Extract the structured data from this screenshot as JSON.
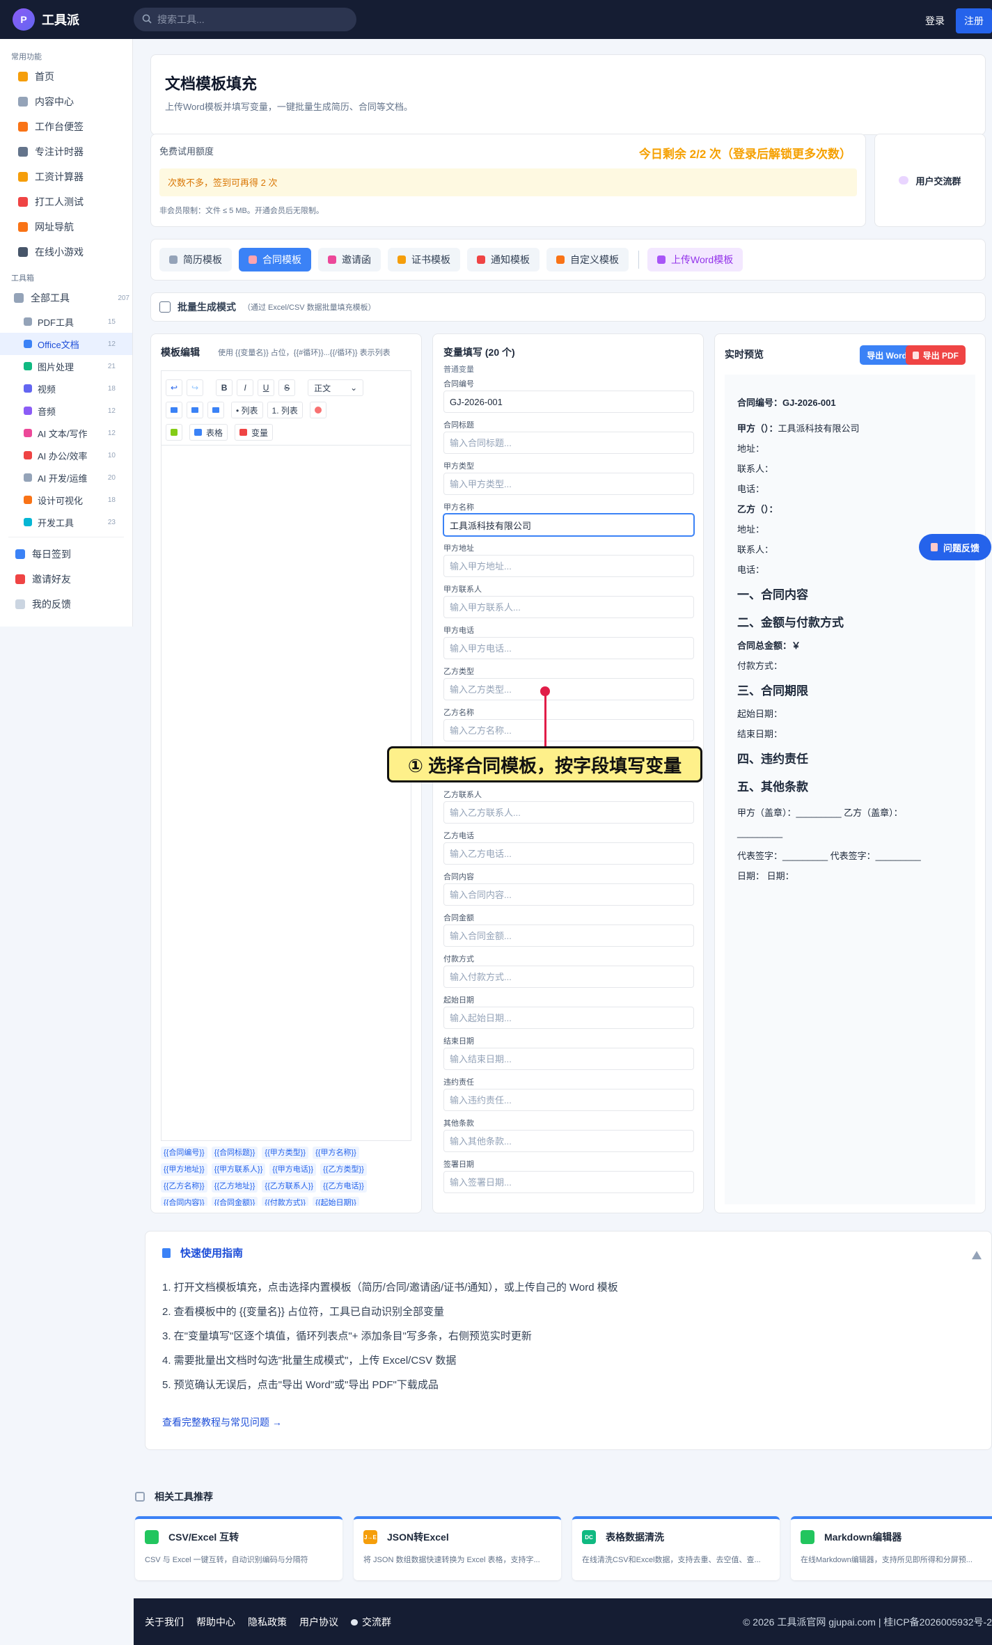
{
  "header": {
    "logo_mark": "P",
    "logo": "工具派",
    "search_placeholder": "搜索工具...",
    "login": "登录",
    "register": "注册"
  },
  "sidebar": {
    "common_caption": "常用功能",
    "common": [
      {
        "label": "首页",
        "color": "#f59e0b"
      },
      {
        "label": "内容中心",
        "color": "#94a3b8"
      },
      {
        "label": "工作台便签",
        "color": "#f97316"
      },
      {
        "label": "专注计时器",
        "color": "#64748b"
      },
      {
        "label": "工资计算器",
        "color": "#f59e0b"
      },
      {
        "label": "打工人测试",
        "color": "#ef4444"
      },
      {
        "label": "网址导航",
        "color": "#f97316"
      },
      {
        "label": "在线小游戏",
        "color": "#475569"
      }
    ],
    "tools_caption": "工具箱",
    "all_tools": "全部工具",
    "all_count": "207",
    "tools": [
      {
        "label": "PDF工具",
        "count": "15",
        "color": "#94a3b8"
      },
      {
        "label": "Office文档",
        "count": "12",
        "color": "#3b82f6"
      },
      {
        "label": "图片处理",
        "count": "21",
        "color": "#10b981"
      },
      {
        "label": "视频",
        "count": "18",
        "color": "#6366f1"
      },
      {
        "label": "音频",
        "count": "12",
        "color": "#8b5cf6"
      },
      {
        "label": "AI 文本/写作",
        "count": "12",
        "color": "#ec4899"
      },
      {
        "label": "AI 办公/效率",
        "count": "10",
        "color": "#ef4444"
      },
      {
        "label": "AI 开发/运维",
        "count": "20",
        "color": "#94a3b8"
      },
      {
        "label": "设计可视化",
        "count": "18",
        "color": "#f97316"
      },
      {
        "label": "开发工具",
        "count": "23",
        "color": "#06b6d4"
      }
    ],
    "bottom": [
      {
        "label": "每日签到",
        "color": "#3b82f6"
      },
      {
        "label": "邀请好友",
        "color": "#ef4444"
      },
      {
        "label": "我的反馈",
        "color": "#cbd5e1"
      }
    ]
  },
  "page": {
    "title": "文档模板填充",
    "subtitle": "上传Word模板并填写变量，一键批量生成简历、合同等文档。"
  },
  "quota": {
    "label": "免费试用额度",
    "remain": "今日剩余 2/2 次（登录后解锁更多次数）",
    "tip": "次数不多，签到可再得 2 次",
    "limit": "非会员限制：文件 ≤ 5 MB。开通会员后无限制。",
    "group": "用户交流群"
  },
  "tabs": [
    {
      "label": "简历模板",
      "color": "#94a3b8"
    },
    {
      "label": "合同模板",
      "color": "#fda4af"
    },
    {
      "label": "邀请函",
      "color": "#ec4899"
    },
    {
      "label": "证书模板",
      "color": "#f59e0b"
    },
    {
      "label": "通知模板",
      "color": "#ef4444"
    },
    {
      "label": "自定义模板",
      "color": "#f97316"
    }
  ],
  "upload_tab": "上传Word模板",
  "batch": {
    "label": "批量生成模式",
    "hint": "（通过 Excel/CSV 数据批量填充模板）"
  },
  "editor": {
    "title": "模板编辑",
    "hint": "使用 {{变量名}} 占位，{{#循环}}...{{/循环}} 表示列表",
    "tb": {
      "undo": "↩",
      "redo": "↪",
      "bold": "B",
      "italic": "I",
      "underline": "U",
      "strike": "S",
      "style": "正文",
      "ul": "• 列表",
      "ol": "1. 列表",
      "table": "表格",
      "variable": "变量"
    },
    "chips": [
      "{{合同编号}}",
      "{{合同标题}}",
      "{{甲方类型}}",
      "{{甲方名称}}",
      "{{甲方地址}}",
      "{{甲方联系人}}",
      "{{甲方电话}}",
      "{{乙方类型}}",
      "{{乙方名称}}",
      "{{乙方地址}}",
      "{{乙方联系人}}",
      "{{乙方电话}}",
      "{{合同内容}}",
      "{{合同金额}}",
      "{{付款方式}}",
      "{{起始日期}}"
    ]
  },
  "vars": {
    "title": "变量填写 (20 个)",
    "group": "普通变量",
    "fields": [
      {
        "label": "合同编号",
        "value": "GJ-2026-001",
        "placeholder": ""
      },
      {
        "label": "合同标题",
        "value": "",
        "placeholder": "输入合同标题..."
      },
      {
        "label": "甲方类型",
        "value": "",
        "placeholder": "输入甲方类型..."
      },
      {
        "label": "甲方名称",
        "value": "工具派科技有限公司",
        "placeholder": ""
      },
      {
        "label": "甲方地址",
        "value": "",
        "placeholder": "输入甲方地址..."
      },
      {
        "label": "甲方联系人",
        "value": "",
        "placeholder": "输入甲方联系人..."
      },
      {
        "label": "甲方电话",
        "value": "",
        "placeholder": "输入甲方电话..."
      },
      {
        "label": "乙方类型",
        "value": "",
        "placeholder": "输入乙方类型..."
      },
      {
        "label": "乙方名称",
        "value": "",
        "placeholder": "输入乙方名称..."
      },
      {
        "label": "",
        "value": "",
        "placeholder": ""
      },
      {
        "label": "乙方联系人",
        "value": "",
        "placeholder": "输入乙方联系人..."
      },
      {
        "label": "乙方电话",
        "value": "",
        "placeholder": "输入乙方电话..."
      },
      {
        "label": "合同内容",
        "value": "",
        "placeholder": "输入合同内容..."
      },
      {
        "label": "合同金额",
        "value": "",
        "placeholder": "输入合同金额..."
      },
      {
        "label": "付款方式",
        "value": "",
        "placeholder": "输入付款方式..."
      },
      {
        "label": "起始日期",
        "value": "",
        "placeholder": "输入起始日期..."
      },
      {
        "label": "结束日期",
        "value": "",
        "placeholder": "输入结束日期..."
      },
      {
        "label": "违约责任",
        "value": "",
        "placeholder": "输入违约责任..."
      },
      {
        "label": "其他条款",
        "value": "",
        "placeholder": "输入其他条款..."
      },
      {
        "label": "签署日期",
        "value": "",
        "placeholder": "输入签署日期..."
      }
    ]
  },
  "preview": {
    "title": "实时预览",
    "export_word": "导出 Word",
    "export_pdf": "导出 PDF",
    "l1_label": "合同编号：",
    "l1_val": "GJ-2026-001",
    "l2_label": "甲方（）：",
    "l2_val": "工具派科技有限公司",
    "addr": "地址：",
    "contact": "联系人：",
    "phone": "电话：",
    "l_b": "乙方（）：",
    "h1": "一、合同内容",
    "h2": "二、金额与付款方式",
    "amount": "合同总金额：￥",
    "pay": "付款方式：",
    "h3": "三、合同期限",
    "start": "起始日期：",
    "end": "结束日期：",
    "h4": "四、违约责任",
    "h5": "五、其他条款",
    "sign1": "甲方（盖章）：_________ 乙方（盖章）：",
    "sign2": "_________",
    "sign3": "代表签字：_________ 代表签字：_________",
    "sign4": "日期： 日期："
  },
  "feedback": "问题反馈",
  "callout": "① 选择合同模板，按字段填写变量",
  "guide": {
    "title": "快速使用指南",
    "steps": [
      "1. 打开文档模板填充，点击选择内置模板（简历/合同/邀请函/证书/通知），或上传自己的 Word 模板",
      "2. 查看模板中的 {{变量名}} 占位符，工具已自动识别全部变量",
      "3. 在\"变量填写\"区逐个填值，循环列表点\"+ 添加条目\"写多条，右侧预览实时更新",
      "4. 需要批量出文档时勾选\"批量生成模式\"，上传 Excel/CSV 数据",
      "5. 预览确认无误后，点击\"导出 Word\"或\"导出 PDF\"下载成品"
    ],
    "link": "查看完整教程与常见问题 →"
  },
  "related": {
    "title": "相关工具推荐",
    "items": [
      {
        "name": "CSV/Excel 互转",
        "desc": "CSV 与 Excel 一键互转，自动识别编码与分隔符",
        "color": "#22c55e",
        "mark": ""
      },
      {
        "name": "JSON转Excel",
        "desc": "将 JSON 数组数据快速转换为 Excel 表格，支持字...",
        "color": "#f59e0b",
        "mark": "J→E"
      },
      {
        "name": "表格数据清洗",
        "desc": "在线清洗CSV和Excel数据，支持去重、去空值、查...",
        "color": "#10b981",
        "mark": "DC"
      },
      {
        "name": "Markdown编辑器",
        "desc": "在线Markdown编辑器，支持所见即所得和分屏预...",
        "color": "#22c55e",
        "mark": ""
      }
    ]
  },
  "footer": {
    "links": [
      "关于我们",
      "帮助中心",
      "隐私政策",
      "用户协议",
      "交流群"
    ],
    "copy": "© 2026 工具派官网 gjupai.com | 桂ICP备2026005932号-2"
  }
}
